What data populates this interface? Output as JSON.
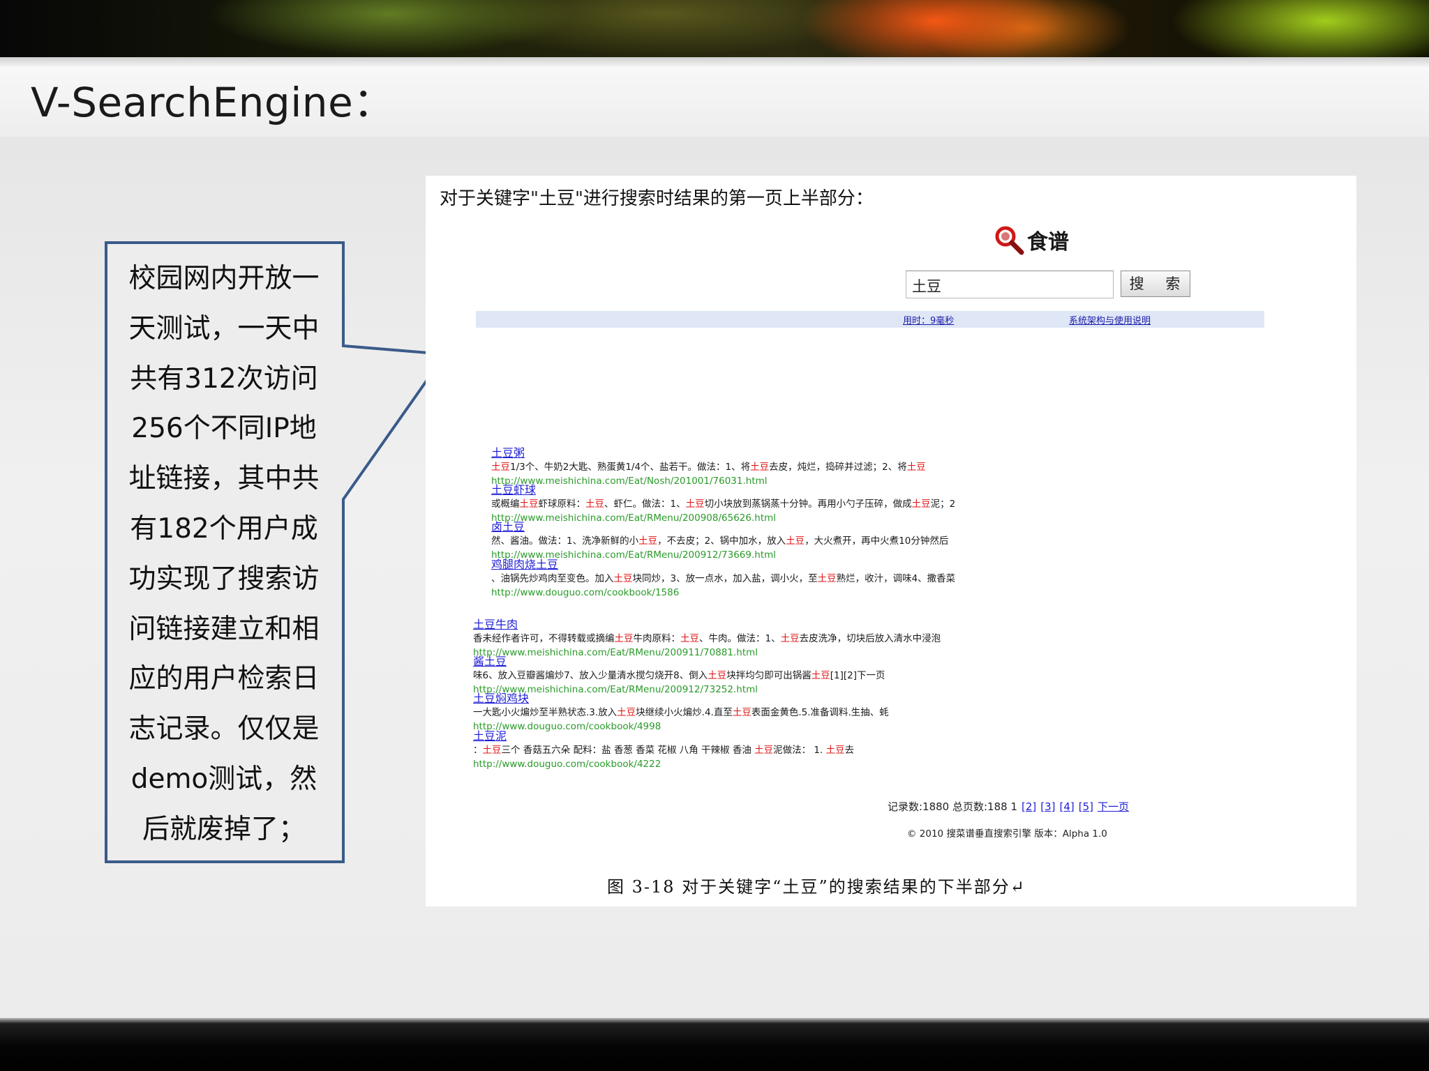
{
  "slide": {
    "title": "V-SearchEngine："
  },
  "callout": {
    "text": "校园网内开放一\n天测试，一天中\n共有312次访问\n256个不同IP地\n址链接，其中共\n有182个用户成\n功实现了搜索访\n问链接建立和相\n应的用户检索日\n志记录。仅仅是\ndemo测试，然\n后就废掉了；",
    "border_color": "#3a5a8a"
  },
  "screenshot": {
    "caption_top": "对于关键字\"土豆\"进行搜索时结果的第一页上半部分：",
    "logo_text": "食谱",
    "logo_icon": "search-magnifier-icon",
    "search": {
      "value": "土豆",
      "button_label": "搜 索"
    },
    "status": {
      "time_label": "用时：9毫秒",
      "help_label": "系统架构与使用说明"
    },
    "results": [
      {
        "title": "土豆粥",
        "snippet": [
          [
            "土豆",
            true
          ],
          [
            "1/3个、牛奶2大匙、熟蛋黄1/4个、盐若干。做法：1、将",
            false
          ],
          [
            "土豆",
            true
          ],
          [
            "去皮，炖烂，捣碎并过滤；2、将",
            false
          ],
          [
            "土豆",
            true
          ]
        ],
        "url": "http://www.meishichina.com/Eat/Nosh/201001/76031.html"
      },
      {
        "title": "土豆虾球",
        "snippet": [
          [
            "或概编",
            false
          ],
          [
            "土豆",
            true
          ],
          [
            "虾球原料：",
            false
          ],
          [
            "土豆",
            true
          ],
          [
            "、虾仁。做法：1、",
            false
          ],
          [
            "土豆",
            true
          ],
          [
            "切小块放到蒸锅蒸十分钟。再用小勺子压碎，做成",
            false
          ],
          [
            "土豆",
            true
          ],
          [
            "泥；2",
            false
          ]
        ],
        "url": "http://www.meishichina.com/Eat/RMenu/200908/65626.html"
      },
      {
        "title": "卤土豆",
        "snippet": [
          [
            "然、酱油。做法：1、洗净新鲜的小",
            false
          ],
          [
            "土豆",
            true
          ],
          [
            "，不去皮；2、锅中加水，放入",
            false
          ],
          [
            "土豆",
            true
          ],
          [
            "，大火煮开，再中火煮10分钟然后",
            false
          ]
        ],
        "url": "http://www.meishichina.com/Eat/RMenu/200912/73669.html"
      },
      {
        "title": "鸡腿肉烧土豆",
        "snippet": [
          [
            "、油锅先炒鸡肉至变色。加入",
            false
          ],
          [
            "土豆",
            true
          ],
          [
            "块同炒，3、放一点水，加入盐，调小火，至",
            false
          ],
          [
            "土豆",
            true
          ],
          [
            "熟烂，收汁，调味4、撒香菜",
            false
          ]
        ],
        "url": "http://www.douguo.com/cookbook/1586"
      },
      {
        "title": "土豆牛肉",
        "snippet": [
          [
            "香未经作者许可，不得转载或摘编",
            false
          ],
          [
            "土豆",
            true
          ],
          [
            "牛肉原料：",
            false
          ],
          [
            "土豆",
            true
          ],
          [
            "、牛肉。做法：1、",
            false
          ],
          [
            "土豆",
            true
          ],
          [
            "去皮洗净，切块后放入清水中浸泡",
            false
          ]
        ],
        "url": "http://www.meishichina.com/Eat/RMenu/200911/70881.html"
      },
      {
        "title": "酱土豆",
        "snippet": [
          [
            "味6、放入豆瓣酱煸炒7、放入少量清水搅匀烧开8、倒入",
            false
          ],
          [
            "土豆",
            true
          ],
          [
            "块拌均匀即可出锅酱",
            false
          ],
          [
            "土豆",
            true
          ],
          [
            "[1][2]下一页",
            false
          ]
        ],
        "url": "http://www.meishichina.com/Eat/RMenu/200912/73252.html"
      },
      {
        "title": "土豆焖鸡块",
        "snippet": [
          [
            "一大匙小火煸炒至半熟状态.3.放入",
            false
          ],
          [
            "土豆",
            true
          ],
          [
            "块继续小火煸炒.4.直至",
            false
          ],
          [
            "土豆",
            true
          ],
          [
            "表面金黄色.5.准备调料.生抽、蚝",
            false
          ]
        ],
        "url": "http://www.douguo.com/cookbook/4998"
      },
      {
        "title": "土豆泥",
        "snippet": [
          [
            "：",
            false
          ],
          [
            "土豆",
            true
          ],
          [
            "三个 香菇五六朵 配料：盐 香葱 香菜 花椒 八角 干辣椒 香油 ",
            false
          ],
          [
            "土豆",
            true
          ],
          [
            "泥做法： 1. ",
            false
          ],
          [
            "土豆",
            true
          ],
          [
            "去",
            false
          ]
        ],
        "url": "http://www.douguo.com/cookbook/4222"
      }
    ],
    "pagination": {
      "summary": "记录数:1880 总页数:188 1",
      "pages": [
        "[2]",
        "[3]",
        "[4]",
        "[5]",
        "下一页"
      ]
    },
    "footer": "© 2010 搜菜谱垂直搜索引擎 版本：Alpha 1.0",
    "figure_caption": "图 3-18 对于关键字“土豆”的搜索结果的下半部分↵"
  }
}
